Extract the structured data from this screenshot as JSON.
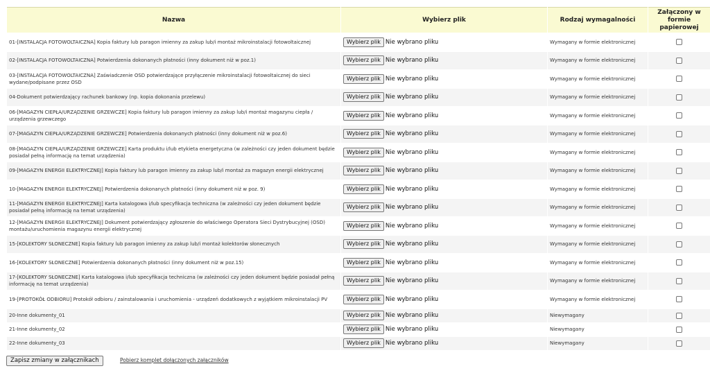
{
  "table": {
    "headers": {
      "name": "Nazwa",
      "file": "Wybierz plik",
      "requirement": "Rodzaj wymagalności",
      "paper": "Załączony w formie papierowej"
    },
    "rows": [
      {
        "name": "01-[INSTALACJA FOTOWOLTAICZNA] Kopia faktury lub paragon imienny za zakup lub/i montaż mikroinstalacji fotowoltaicznej",
        "file_button": "Wybierz plik",
        "file_status": "Nie wybrano pliku",
        "requirement": "Wymagany w formie elektronicznej"
      },
      {
        "name": "02-[INSTALACJA FOTOWOLTAICZNA] Potwierdzenia dokonanych płatności (inny dokument niż w poz.1)",
        "file_button": "Wybierz plik",
        "file_status": "Nie wybrano pliku",
        "requirement": "Wymagany w formie elektronicznej"
      },
      {
        "name": "03-[INSTALACJA FOTOWOLTAICZNA] Zaświadczenie OSD potwierdzające przyłączenie mikroinstalacji fotowoltaicznej do sieci wydane/podpisane przez OSD",
        "file_button": "Wybierz plik",
        "file_status": "Nie wybrano pliku",
        "requirement": "Wymagany w formie elektronicznej"
      },
      {
        "name": "04-Dokument potwierdzający rachunek bankowy (np. kopia dokonania przelewu)",
        "file_button": "Wybierz plik",
        "file_status": "Nie wybrano pliku",
        "requirement": "Wymagany w formie elektronicznej"
      },
      {
        "name": "06-[MAGAZYN CIEPŁA/URZĄDZENIE GRZEWCZE] Kopia faktury lub paragon imienny za zakup lub/i montaż magazynu ciepła / urządzenia grzewczego",
        "file_button": "Wybierz plik",
        "file_status": "Nie wybrano pliku",
        "requirement": "Wymagany w formie elektronicznej"
      },
      {
        "name": "07-[MAGAZYN CIEPŁA/URZĄDZENIE GRZEWCZE] Potwierdzenia dokonanych płatności (inny dokument niż w poz.6)",
        "file_button": "Wybierz plik",
        "file_status": "Nie wybrano pliku",
        "requirement": "Wymagany w formie elektronicznej"
      },
      {
        "name": "08-[MAGAZYN CIEPŁA/URZĄDZENIE GRZEWCZE] Karta produktu i/lub etykieta energetyczna (w zależności czy jeden dokument będzie posiadał pełną informację na temat urządzenia)",
        "file_button": "Wybierz plik",
        "file_status": "Nie wybrano pliku",
        "requirement": "Wymagany w formie elektronicznej"
      },
      {
        "name": "09-[MAGAZYN ENERGII ELEKTRYCZNEJ] Kopia faktury lub paragon imienny za zakup lub/i montaż za magazyn energii elektrycznej",
        "file_button": "Wybierz plik",
        "file_status": "Nie wybrano pliku",
        "requirement": "Wymagany w formie elektronicznej"
      },
      {
        "name": "10-[MAGAZYN ENERGII ELEKTRYCZNEJ] Potwierdzenia dokonanych płatności (inny dokument niż w poz. 9)",
        "file_button": "Wybierz plik",
        "file_status": "Nie wybrano pliku",
        "requirement": "Wymagany w formie elektronicznej"
      },
      {
        "name": "11-[MAGAZYN ENERGII ELEKTRYCZNEJ] Karta katalogowa i/lub specyfikacja techniczna (w zależności czy jeden dokument będzie posiadał pełną informację na temat urządzenia)",
        "file_button": "Wybierz plik",
        "file_status": "Nie wybrano pliku",
        "requirement": "Wymagany w formie elektronicznej"
      },
      {
        "name": "12-[MAGAZYN ENERGII ELEKTRYCZNEJ] Dokument potwierdzający zgłoszenie do właściwego Operatora Sieci Dystrybucyjnej (OSD) montażu/uruchomienia magazynu energii elektrycznej",
        "file_button": "Wybierz plik",
        "file_status": "Nie wybrano pliku",
        "requirement": "Wymagany w formie elektronicznej"
      },
      {
        "name": "15-[KOLEKTORY SŁONECZNE] Kopia faktury lub paragon imienny za zakup lub/i montaż kolektorów słonecznych",
        "file_button": "Wybierz plik",
        "file_status": "Nie wybrano pliku",
        "requirement": "Wymagany w formie elektronicznej"
      },
      {
        "name": "16-[KOLEKTORY SŁONECZNE] Potwierdzenia dokonanych płatności (inny dokument niż w poz.15)",
        "file_button": "Wybierz plik",
        "file_status": "Nie wybrano pliku",
        "requirement": "Wymagany w formie elektronicznej"
      },
      {
        "name": "17-[KOLEKTORY SŁONECZNE] Karta katalogowa i/lub specyfikacja techniczna (w zależności czy jeden dokument będzie posiadał pełną informację na temat urządzenia)",
        "file_button": "Wybierz plik",
        "file_status": "Nie wybrano pliku",
        "requirement": "Wymagany w formie elektronicznej"
      },
      {
        "name": "19-[PROTOKÓŁ ODBIORU] Protokół odbioru / zainstalowania i uruchomienia - urządzeń dodatkowych z wyjątkiem mikroinstalacji PV",
        "file_button": "Wybierz plik",
        "file_status": "Nie wybrano pliku",
        "requirement": "Wymagany w formie elektronicznej"
      },
      {
        "name": "20-Inne dokumenty_01",
        "file_button": "Wybierz plik",
        "file_status": "Nie wybrano pliku",
        "requirement": "Niewymagany"
      },
      {
        "name": "21-Inne dokumenty_02",
        "file_button": "Wybierz plik",
        "file_status": "Nie wybrano pliku",
        "requirement": "Niewymagany"
      },
      {
        "name": "22-Inne dokumenty_03",
        "file_button": "Wybierz plik",
        "file_status": "Nie wybrano pliku",
        "requirement": "Niewymagany"
      }
    ]
  },
  "footer": {
    "save_label": "Zapisz zmiany w załącznikach",
    "download_label": "Pobierz komplet dołączonych załączników"
  }
}
